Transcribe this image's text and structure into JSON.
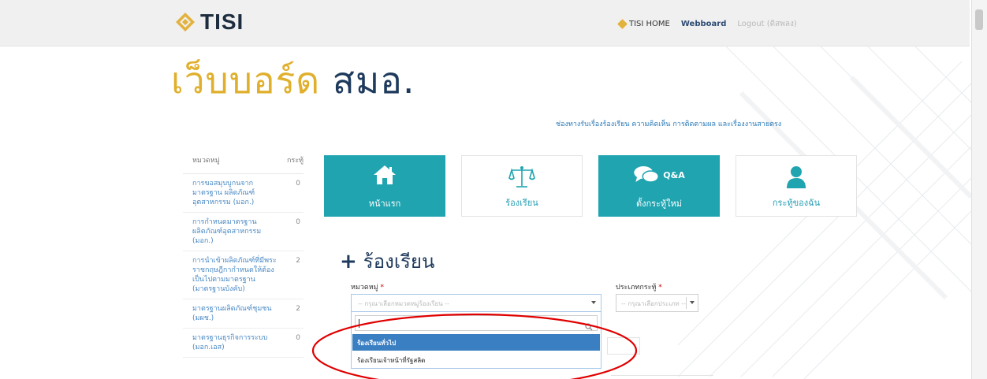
{
  "header": {
    "logo_text": "TISI",
    "nav": {
      "home_label": "TISI HOME",
      "webboard_label": "Webboard",
      "logout_label": "Logout (ดิสพลง)"
    }
  },
  "page": {
    "title_part1": "เว็บบอร์ด",
    "title_part2": "สมอ.",
    "top_links": "ช่องทางรับเรื่องร้องเรียน ความคิดเห็น การติดตามผล และเรื่องงานสายตรง"
  },
  "sidebar": {
    "header_label": "หมวดหมู่",
    "header_count": "กระทู้",
    "items": [
      {
        "label": "การขอสมุบบูกนจากมาตรฐาน ผลิตภัณฑ์อุตสาหกรรม (มอก.)",
        "count": "0"
      },
      {
        "label": "การกำหนดมาตรฐาน ผลิตภัณฑ์อุตสาหกรรม (มอก.)",
        "count": "0"
      },
      {
        "label": "การนำเข้าผลิตภัณฑ์ที่มีพระ ราชกฤษฎีกากำหนดให้ต้อง เป็นไปตามมาตรฐาน (มาตรฐานบังคับ)",
        "count": "2"
      },
      {
        "label": "มาตรฐานผลิตภัณฑ์ชุมชน (มผช.)",
        "count": "2"
      },
      {
        "label": "มาตรฐานธุรกิจการระบบ (มอก.เอส)",
        "count": "0"
      }
    ]
  },
  "tiles": [
    {
      "label": "หน้าแรก",
      "icon": "home-icon",
      "style": "teal"
    },
    {
      "label": "ร้องเรียน",
      "icon": "scales-icon",
      "style": "white"
    },
    {
      "label": "ตั้งกระทู้ใหม่",
      "icon": "chat-icon",
      "badge": "Q&A",
      "style": "teal"
    },
    {
      "label": "กระทู้ของฉัน",
      "icon": "user-icon",
      "style": "white"
    }
  ],
  "form": {
    "section_title": "ร้องเรียน",
    "category_label": "หมวดหมู่",
    "category_placeholder": "-- กรุณาเลือกหมวดหมู่ร้องเรียน --",
    "type_label": "ประเภทกระทู้",
    "type_placeholder": "-- กรุณาเลือกประเภท --",
    "required_mark": "*",
    "search_value": "",
    "options": [
      {
        "label": "ร้องเรียนทั่วไป",
        "selected": true
      },
      {
        "label": "ร้องเรียนเจ้าหน้าที่รัฐสลิต",
        "selected": false
      }
    ]
  },
  "colors": {
    "teal": "#1fa4b0",
    "gold": "#e0b02d",
    "navy": "#1e3a5c",
    "selected_option": "#3a7fc2",
    "annotation": "#e00000"
  }
}
